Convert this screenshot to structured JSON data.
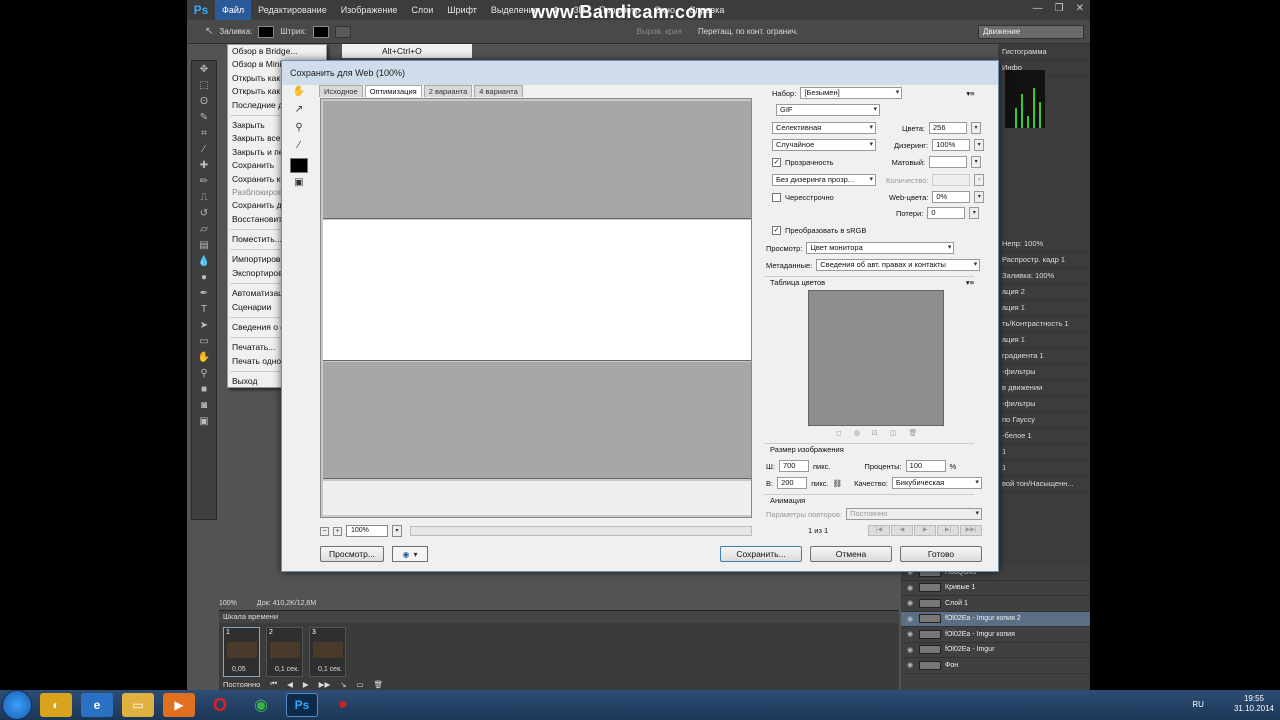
{
  "watermark": "www.Bandicam.com",
  "app": {
    "logo": "Ps",
    "menu": [
      "Файл",
      "Редактирование",
      "Изображение",
      "Слои",
      "Шрифт",
      "Выделение",
      "Ф",
      "3D",
      "Просмотр",
      "Окно",
      "Справка"
    ]
  },
  "options_bar": {
    "fill_label": "Заливка:",
    "stroke_label": "Штрих:",
    "edge_label": "Выров. края",
    "constraint_label": "Перетащ. по конт. огранич.",
    "workspace": "Движение"
  },
  "file_menu": {
    "items": [
      {
        "label": "Обзор в Bridge...",
        "shortcut": "Alt+Ctrl+O",
        "disabled": false
      },
      {
        "label": "Обзор в Mini",
        "disabled": false
      },
      {
        "label": "Открыть как",
        "disabled": false
      },
      {
        "label": "Открыть как",
        "disabled": false
      },
      {
        "label": "Последние д",
        "disabled": false
      },
      {
        "sep": true
      },
      {
        "label": "Закрыть",
        "disabled": false
      },
      {
        "label": "Закрыть все",
        "disabled": false
      },
      {
        "label": "Закрыть и пе",
        "disabled": false
      },
      {
        "label": "Сохранить",
        "disabled": false
      },
      {
        "label": "Сохранить ка",
        "disabled": false
      },
      {
        "label": "Разблокиров",
        "disabled": true
      },
      {
        "label": "Сохранить дл",
        "disabled": false
      },
      {
        "label": "Восстановит",
        "disabled": false
      },
      {
        "sep": true
      },
      {
        "label": "Поместить...",
        "disabled": false
      },
      {
        "sep": true
      },
      {
        "label": "Импортиров",
        "disabled": false
      },
      {
        "label": "Экспортиров",
        "disabled": false
      },
      {
        "sep": true
      },
      {
        "label": "Автоматизац",
        "disabled": false
      },
      {
        "label": "Сценарии",
        "disabled": false
      },
      {
        "sep": true
      },
      {
        "label": "Сведения о ф",
        "disabled": false
      },
      {
        "sep": true
      },
      {
        "label": "Печатать...",
        "disabled": false
      },
      {
        "label": "Печать одно",
        "disabled": false
      },
      {
        "sep": true
      },
      {
        "label": "Выход",
        "disabled": false
      }
    ]
  },
  "status": {
    "zoom": "100%",
    "doc": "Док: 410,2K/12,6M"
  },
  "timeline": {
    "title": "Шкала времени",
    "frames": [
      {
        "num": "1",
        "time": "0,05"
      },
      {
        "num": "2",
        "time": "0,1 сек."
      },
      {
        "num": "3",
        "time": "0,1 сек."
      }
    ],
    "loop": "Постоянно"
  },
  "right_panel_rows": [
    "Гистограмма",
    "Инфо",
    "Непр: 100%",
    "Распростр. кадр 1",
    "Заливка: 100%",
    "ация 2",
    "ация 1",
    "ть/Контрастность 1",
    "ация 1",
    "градиента 1",
    "-фильтры",
    "в движении",
    "-фильтры",
    "по Гауссу",
    "-белое 1",
    "1",
    "1",
    "вой тон/Насыщенн..."
  ],
  "layers": [
    {
      "name": "Н6dQOx3",
      "selected": false
    },
    {
      "name": "Кривые 1",
      "selected": false
    },
    {
      "name": "Слой 1",
      "selected": false
    },
    {
      "name": "fOl02Ea - Imgur копия 2",
      "selected": true
    },
    {
      "name": "fOl02Ea - Imgur копия",
      "selected": false
    },
    {
      "name": "fOl02Ea - Imgur",
      "selected": false
    },
    {
      "name": "Фон",
      "selected": false
    }
  ],
  "dialog": {
    "title": "Сохранить для Web (100%)",
    "tabs": [
      "Исходное",
      "Оптимизация",
      "2 варианта",
      "4 варианта"
    ],
    "active_tab": 1,
    "zoom": "100%",
    "buttons": {
      "preview": "Просмотр...",
      "save": "Сохранить...",
      "cancel": "Отмена",
      "done": "Готово"
    },
    "settings": {
      "preset_label": "Набор:",
      "preset_value": "[Безымен]",
      "format_value": "GIF",
      "reduction": "Селективная",
      "colors_label": "Цвета:",
      "colors_value": "256",
      "dither_algo": "Случайное",
      "dither_label": "Дизеринг:",
      "dither_value": "100%",
      "transparency_label": "Прозрачность",
      "matte_label": "Матовый:",
      "trans_dither": "Без дизеринга прозр...",
      "amount_label": "Количество:",
      "interlaced_label": "Чересстрочно",
      "web_snap_label": "Web-цвета:",
      "web_snap_value": "0%",
      "lossy_label": "Потери:",
      "lossy_value": "0",
      "srgb_label": "Преобразовать в sRGB",
      "preview_label": "Просмотр:",
      "preview_value": "Цвет монитора",
      "metadata_label": "Метаданные:",
      "metadata_value": "Сведения об авт. правах и контакты",
      "color_table_label": "Таблица цветов",
      "image_size_label": "Размер изображения",
      "w_label": "Ш:",
      "w_value": "700",
      "h_label": "В:",
      "h_value": "200",
      "px": "пикс.",
      "percent_label": "Проценты:",
      "percent_value": "100",
      "percent_unit": "%",
      "quality_label": "Качество:",
      "quality_value": "Бикубическая",
      "animation_label": "Анимация",
      "loop_label": "Параметры повторов:",
      "loop_value": "Постоянно",
      "frame_counter": "1 из 1"
    }
  },
  "taskbar": {
    "lang": "RU",
    "time": "19:55",
    "date": "31.10.2014",
    "icons": [
      "ie-icon",
      "folder-icon",
      "media-icon",
      "opera-icon",
      "chrome-icon",
      "photoshop-icon",
      "bandicam-icon"
    ]
  }
}
